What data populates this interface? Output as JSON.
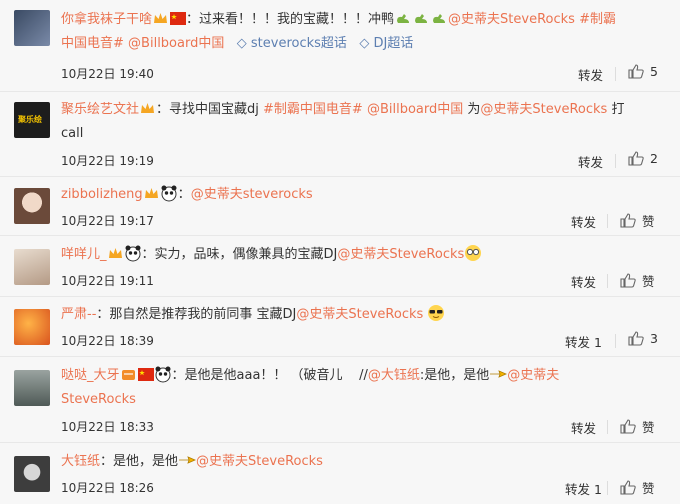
{
  "comments": [
    {
      "user": "你拿我袜子干啥",
      "text_before": "：过来看！！！我的宝藏！！！冲鸭",
      "mention": "@史蒂夫SteveRocks",
      "tag1": "#制霸",
      "line2": "中国电音#",
      "mention2": "@Billboard中国",
      "link1": "steverocks超话",
      "link2": "DJ超话",
      "time": "10月22日 19:40",
      "repost": "转发",
      "likes": "5"
    },
    {
      "user": "聚乐绘艺文社",
      "text_before": "：寻找中国宝藏dj",
      "tag1": "#制霸中国电音#",
      "mention": "@Billboard中国",
      "mid": "为",
      "mention2": "@史蒂夫SteveRocks",
      "tail": "打",
      "line2": "call",
      "time": "10月22日 19:19",
      "repost": "转发",
      "likes": "2"
    },
    {
      "user": "zibbolizheng",
      "text_before": "：",
      "mention": "@史蒂夫steverocks",
      "time": "10月22日 19:17",
      "repost": "转发",
      "likes": "赞"
    },
    {
      "user": "咩咩儿_",
      "text_before": "：实力，品味，偶像兼具的宝藏DJ",
      "mention": "@史蒂夫SteveRocks",
      "time": "10月22日 19:11",
      "repost": "转发",
      "likes": "赞"
    },
    {
      "user": "严肃--",
      "text_before": "：那自然是推荐我的前同事 宝藏DJ",
      "mention": "@史蒂夫SteveRocks",
      "time": "10月22日 18:39",
      "repost": "转发 1",
      "likes": "3"
    },
    {
      "user": "哒哒_大牙",
      "text_before": "：是他是他aaa！！ （破音儿",
      "slashes": "//",
      "mention": "@大钰纸",
      "mid": ":是他，是他",
      "mention2": "@史蒂夫",
      "line2": "SteveRocks",
      "time": "10月22日 18:33",
      "repost": "转发",
      "likes": "赞"
    },
    {
      "user": "大钰纸",
      "text_before": "：是他，是他",
      "mention": "@史蒂夫SteveRocks",
      "time": "10月22日 18:26",
      "repost": "转发 1",
      "likes": "赞"
    }
  ]
}
